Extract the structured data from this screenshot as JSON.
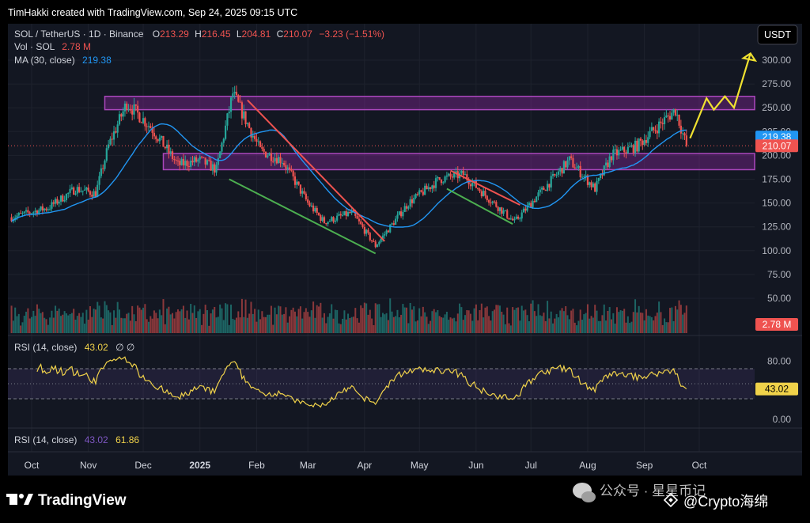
{
  "header": {
    "credit": "TimHakki created with TradingView.com, Sep 24, 2025 09:15 UTC"
  },
  "legend": {
    "symbol": "SOL / TetherUS · 1D · Binance",
    "o_label": "O",
    "o": "213.29",
    "h_label": "H",
    "h": "216.45",
    "l_label": "L",
    "l": "204.81",
    "c_label": "C",
    "c": "210.07",
    "change": "−3.23 (−1.51%)",
    "vol_label": "Vol · SOL",
    "vol": "2.78 M",
    "ma_label": "MA (30, close)",
    "ma": "219.38"
  },
  "currency_button": "USDT",
  "rsi_panel": {
    "label": "RSI (14, close)",
    "value": "43.02",
    "icons": "∅ ∅"
  },
  "rsi_panel2": {
    "label": "RSI (14, close)",
    "value": "43.02",
    "value2": "61.86"
  },
  "footer": {
    "brand": "TradingView",
    "watermark": "公众号 · 星星币记",
    "author": "@Crypto海绵"
  },
  "colors": {
    "bg": "#131722",
    "up": "#26a69a",
    "down": "#ef5350",
    "ma": "#2196f3",
    "rsi": "#f0d24a",
    "zone": "#9c27b0"
  },
  "chart_data": {
    "type": "candlestick",
    "symbol": "SOL/USDT",
    "x_ticks": [
      "Oct",
      "Nov",
      "Dec",
      "2025",
      "Feb",
      "Mar",
      "Apr",
      "May",
      "Jun",
      "Jul",
      "Aug",
      "Sep",
      "Oct"
    ],
    "price_ticks": [
      300,
      275,
      250,
      225,
      200,
      175,
      150,
      125,
      100,
      75,
      50
    ],
    "price_tick_labels": [
      "300.00",
      "275.00",
      "250.00",
      "225.00",
      "200.00",
      "175.00",
      "150.00",
      "125.00",
      "100.00",
      "75.00",
      "50.00"
    ],
    "ylim": [
      45,
      312
    ],
    "last_price": 210.07,
    "last_price_label": "210.07",
    "ma_value": 219.38,
    "ma_label": "219.38",
    "volume_label": "2.78 M",
    "rsi_ticks": [
      80,
      0
    ],
    "rsi_tick_labels": [
      "80.00",
      "0.00"
    ],
    "rsi_last": 43.02,
    "rsi_last_label": "43.02",
    "anchors": [
      [
        "2024-09-20",
        135
      ],
      [
        "2024-10-10",
        145
      ],
      [
        "2024-10-25",
        165
      ],
      [
        "2024-11-05",
        160
      ],
      [
        "2024-11-12",
        210
      ],
      [
        "2024-11-22",
        255
      ],
      [
        "2024-12-05",
        230
      ],
      [
        "2024-12-20",
        190
      ],
      [
        "2025-01-01",
        195
      ],
      [
        "2025-01-10",
        185
      ],
      [
        "2025-01-19",
        265
      ],
      [
        "2025-02-03",
        205
      ],
      [
        "2025-02-15",
        195
      ],
      [
        "2025-03-01",
        150
      ],
      [
        "2025-03-10",
        130
      ],
      [
        "2025-03-25",
        140
      ],
      [
        "2025-04-07",
        105
      ],
      [
        "2025-04-25",
        150
      ],
      [
        "2025-05-12",
        175
      ],
      [
        "2025-05-25",
        180
      ],
      [
        "2025-06-05",
        160
      ],
      [
        "2025-06-22",
        130
      ],
      [
        "2025-07-01",
        150
      ],
      [
        "2025-07-22",
        195
      ],
      [
        "2025-08-05",
        165
      ],
      [
        "2025-08-14",
        200
      ],
      [
        "2025-08-28",
        210
      ],
      [
        "2025-09-18",
        248
      ],
      [
        "2025-09-24",
        210
      ]
    ],
    "resistance_zone": [
      248,
      262
    ],
    "support_zone": [
      185,
      202
    ],
    "trendlines": [
      {
        "color": "#ef5350",
        "from": [
          "2025-01-27",
          258
        ],
        "to": [
          "2025-04-12",
          110
        ]
      },
      {
        "color": "#4caf50",
        "from": [
          "2025-01-17",
          175
        ],
        "to": [
          "2025-04-07",
          97
        ]
      },
      {
        "color": "#ef5350",
        "from": [
          "2025-05-18",
          184
        ],
        "to": [
          "2025-06-25",
          148
        ]
      },
      {
        "color": "#4caf50",
        "from": [
          "2025-05-16",
          165
        ],
        "to": [
          "2025-06-21",
          128
        ]
      }
    ],
    "projection": [
      [
        "2025-09-26",
        218
      ],
      [
        "2025-10-05",
        260
      ],
      [
        "2025-10-09",
        248
      ],
      [
        "2025-10-15",
        262
      ],
      [
        "2025-10-20",
        250
      ],
      [
        "2025-10-29",
        307
      ]
    ]
  }
}
